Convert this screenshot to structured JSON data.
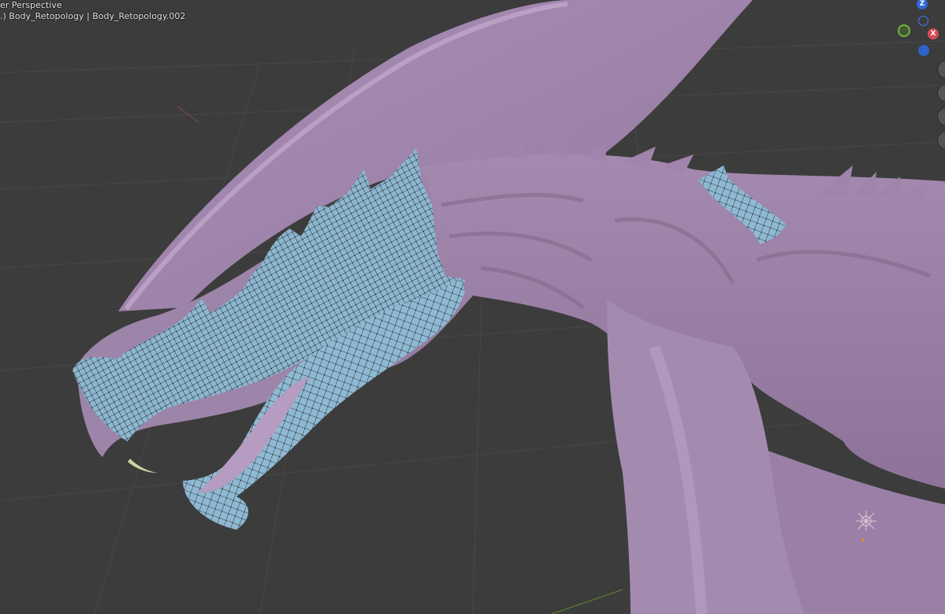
{
  "viewport": {
    "view_title": "er Perspective",
    "object_info": ".) Body_Retopology | Body_Retopology.002"
  },
  "gizmo": {
    "z_label": "Z",
    "x_label": "X",
    "colors": {
      "z": "#2f68d6",
      "y": "#6fb63a",
      "x": "#d94a52"
    }
  },
  "scene": {
    "colors": {
      "background": "#3c3c3c",
      "sculpt_mesh": "#a58bb1",
      "retopology_mesh": "#8db6cf",
      "wireframe": "#111111",
      "tooth": "#c9d8a0"
    },
    "icons": [
      "light-empty-icon",
      "viewport-tool-icon"
    ]
  }
}
